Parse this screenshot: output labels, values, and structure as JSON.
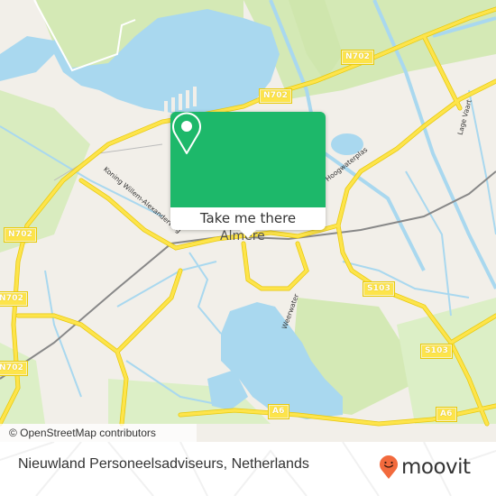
{
  "map": {
    "road_labels": [
      {
        "id": "n702-top-right",
        "text": "N702"
      },
      {
        "id": "n702-center",
        "text": "N702"
      },
      {
        "id": "n702-left-upper",
        "text": "N702"
      },
      {
        "id": "n702-left-lower",
        "text": "N702"
      },
      {
        "id": "n702-left-bottom",
        "text": "N702"
      },
      {
        "id": "s103-upper",
        "text": "S103"
      },
      {
        "id": "s103-lower",
        "text": "S103"
      },
      {
        "id": "a6-left",
        "text": "A6"
      },
      {
        "id": "a6-right",
        "text": "A6"
      }
    ],
    "street_labels": [
      {
        "id": "koning-willem",
        "text": "Koning Willem-Alexanderweg"
      },
      {
        "id": "weerwater",
        "text": "Weerwater"
      },
      {
        "id": "hoogwaterplas",
        "text": "Hoogwaterplas"
      },
      {
        "id": "lage-vaart",
        "text": "Lage Vaart"
      },
      {
        "id": "almere",
        "text": "Almere"
      }
    ],
    "attribution": "© OpenStreetMap contributors",
    "colors": {
      "water": "#a9d8ef",
      "green": "#d4e9b5",
      "land": "#f2efe9",
      "road": "#fde44b"
    }
  },
  "popup": {
    "button_label": "Take me there",
    "icon": "map-pin-icon",
    "color": "#1db86a"
  },
  "footer": {
    "place_name": "Nieuwland Personeelsadviseurs, Netherlands",
    "logo_text": "moovit",
    "logo_color": "#f26a3d"
  }
}
